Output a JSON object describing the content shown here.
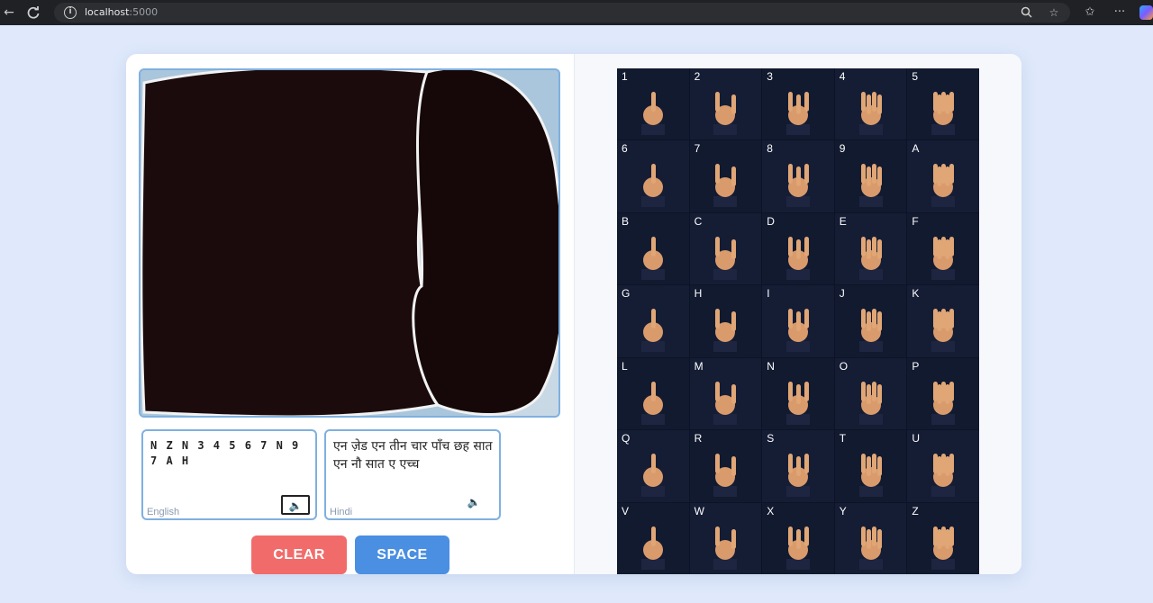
{
  "browser": {
    "url_host": "localhost",
    "url_port": ":5000",
    "icons": [
      "back-arrow-icon",
      "reload-icon",
      "info-icon",
      "zoom-icon",
      "star-icon",
      "favorites-icon",
      "more-icon",
      "copilot-icon"
    ]
  },
  "output": {
    "english_text": "N Z N 3 4 5 6 7 N 9 7 A H",
    "english_label": "English",
    "hindi_text": "एन ज़ेड एन तीन चार पाँच छह सात एन नौ सात ए एच्च",
    "hindi_label": "Hindi"
  },
  "buttons": {
    "clear": "CLEAR",
    "space": "SPACE"
  },
  "sign_chart": {
    "labels": [
      "1",
      "2",
      "3",
      "4",
      "5",
      "6",
      "7",
      "8",
      "9",
      "A",
      "B",
      "C",
      "D",
      "E",
      "F",
      "G",
      "H",
      "I",
      "J",
      "K",
      "L",
      "M",
      "N",
      "O",
      "P",
      "Q",
      "R",
      "S",
      "T",
      "U",
      "V",
      "W",
      "X",
      "Y",
      "Z"
    ]
  },
  "colors": {
    "clear_button": "#f26b6b",
    "space_button": "#4a8fe2",
    "panel_border": "#7fb0e0",
    "chart_background": "#121a30"
  }
}
